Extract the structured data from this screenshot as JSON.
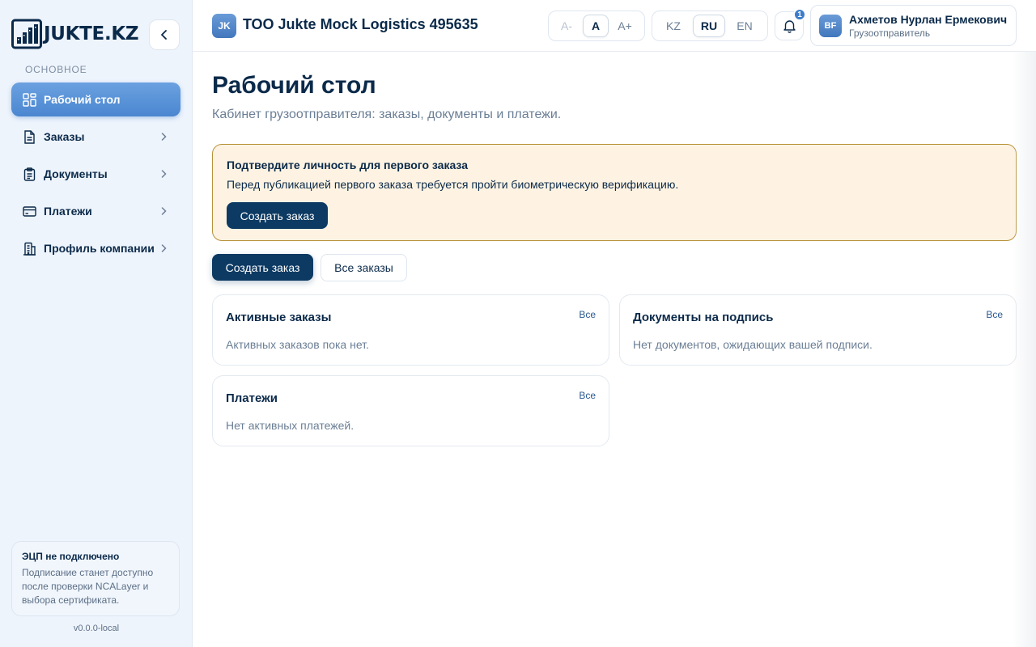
{
  "brand": {
    "logo_text": "JUKTE.KZ"
  },
  "sidebar": {
    "section_label": "ОСНОВНОЕ",
    "items": [
      {
        "label": "Рабочий стол",
        "icon": "dashboard-icon",
        "active": true
      },
      {
        "label": "Заказы",
        "icon": "document-icon"
      },
      {
        "label": "Документы",
        "icon": "clipboard-icon"
      },
      {
        "label": "Платежи",
        "icon": "credit-card-icon"
      },
      {
        "label": "Профиль компании",
        "icon": "building-icon"
      }
    ],
    "eds": {
      "title": "ЭЦП не подключено",
      "text": "Подписание станет доступно после проверки NCALayer и выбора сертификата."
    },
    "version": "v0.0.0-local"
  },
  "header": {
    "company_initials": "JK",
    "company_name": "ТОО Jukte Mock Logistics 495635",
    "font_size": {
      "options": [
        "A-",
        "A",
        "A+"
      ],
      "selected": "A"
    },
    "language": {
      "options": [
        "KZ",
        "RU",
        "EN"
      ],
      "selected": "RU"
    },
    "notifications_count": "1",
    "user": {
      "initials": "BF",
      "name": "Ахметов Нурлан Ермекович",
      "role": "Грузоотправитель"
    }
  },
  "main": {
    "title": "Рабочий стол",
    "subtitle": "Кабинет грузоотправителя: заказы, документы и платежи.",
    "alert": {
      "title": "Подтвердите личность для первого заказа",
      "text": "Перед публикацией первого заказа требуется пройти биометрическую верификацию.",
      "button": "Создать заказ"
    },
    "actions": {
      "create": "Создать заказ",
      "all": "Все заказы"
    },
    "cards": [
      {
        "title": "Активные заказы",
        "link": "Все",
        "empty": "Активных заказов пока нет."
      },
      {
        "title": "Документы на подпись",
        "link": "Все",
        "empty": "Нет документов, ожидающих вашей подписи."
      },
      {
        "title": "Платежи",
        "link": "Все",
        "empty": "Нет активных платежей."
      }
    ]
  },
  "colors": {
    "accent": "#4a86d0",
    "primary_button": "#0d3a63",
    "alert_bg": "#fef3e2",
    "alert_border": "#b8923a"
  }
}
